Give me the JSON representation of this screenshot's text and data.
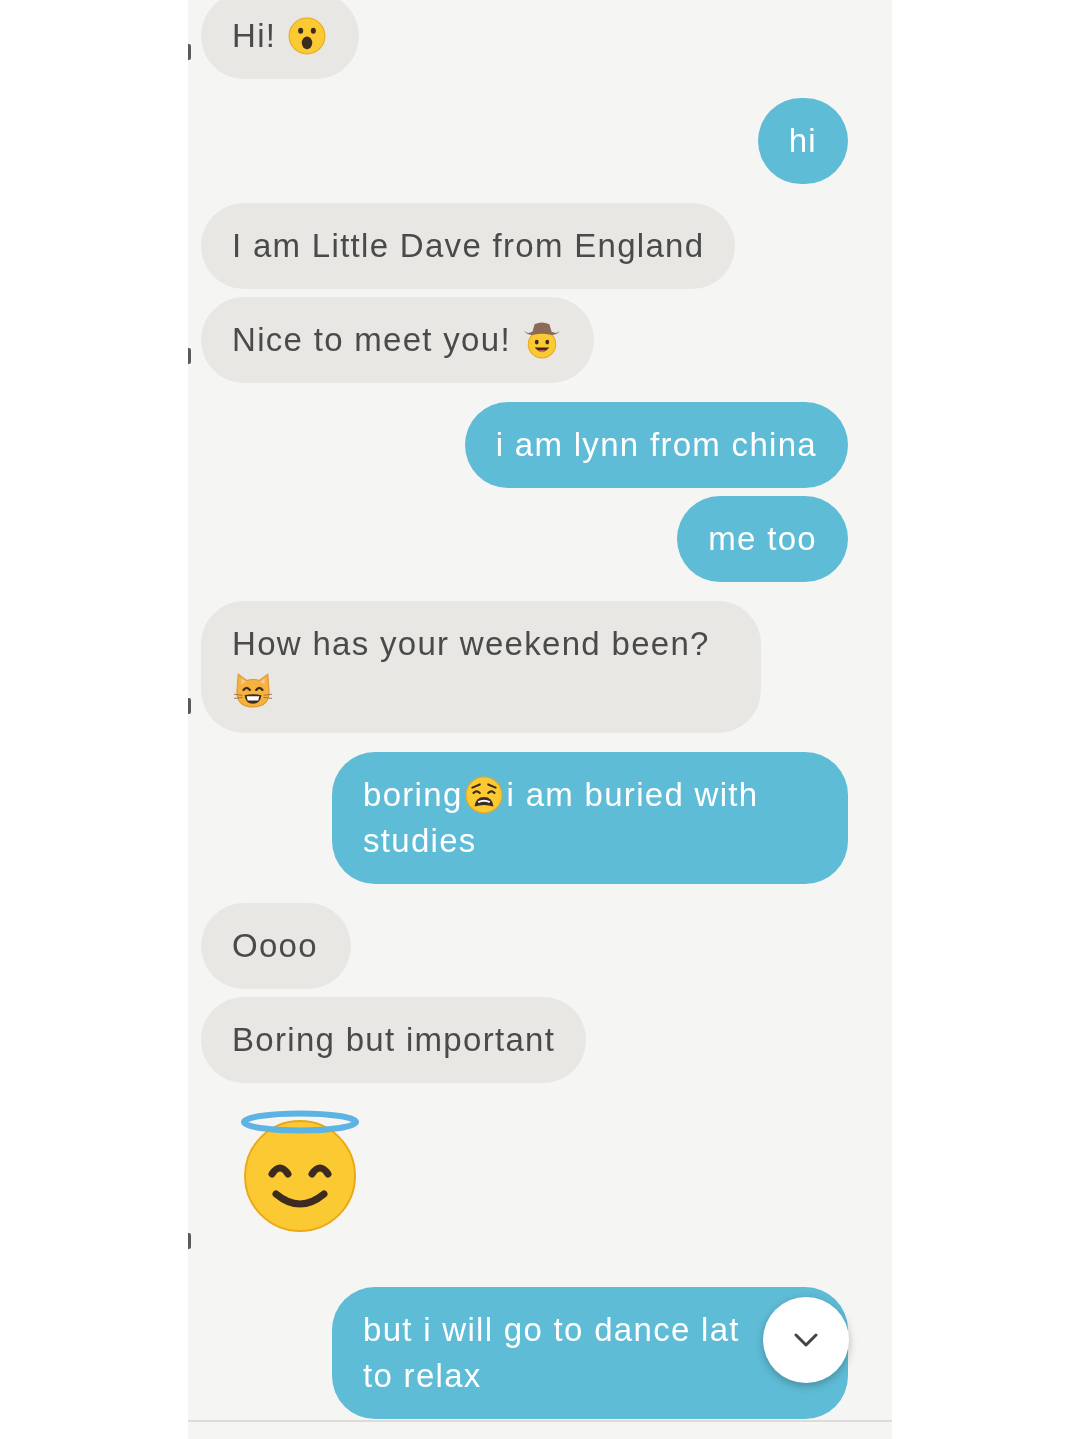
{
  "messages": [
    {
      "kind": "bubble",
      "outgoing": false,
      "avatar_edge": true,
      "lines": [
        [
          {
            "kind": "text",
            "text": "Hi!"
          },
          {
            "kind": "emoji"
          }
        ]
      ]
    },
    {
      "kind": "bubble",
      "outgoing": true,
      "lines": [
        [
          {
            "kind": "text",
            "text": "hi"
          }
        ]
      ]
    },
    {
      "kind": "bubble",
      "outgoing": false,
      "avatar_edge": false,
      "lines": [
        [
          {
            "kind": "text",
            "text": "I am Little Dave from England"
          }
        ]
      ]
    },
    {
      "kind": "bubble",
      "outgoing": false,
      "avatar_edge": true,
      "lines": [
        [
          {
            "kind": "text",
            "text": "Nice to meet you!"
          },
          {
            "kind": "emoji"
          }
        ]
      ]
    },
    {
      "kind": "bubble",
      "outgoing": true,
      "lines": [
        [
          {
            "kind": "text",
            "text": "i am lynn from china"
          }
        ]
      ]
    },
    {
      "kind": "bubble",
      "outgoing": true,
      "lines": [
        [
          {
            "kind": "text",
            "text": "me too"
          }
        ]
      ]
    },
    {
      "kind": "bubble",
      "outgoing": false,
      "avatar_edge": true,
      "lines": [
        [
          {
            "kind": "text",
            "text": "How has your weekend been?"
          }
        ],
        [
          {
            "kind": "emoji"
          }
        ]
      ]
    },
    {
      "kind": "bubble",
      "outgoing": true,
      "lines": [
        [
          {
            "kind": "text",
            "text": "boring"
          },
          {
            "kind": "emoji"
          },
          {
            "kind": "text",
            "text": "i am buried with"
          }
        ],
        [
          {
            "kind": "text",
            "text": "studies"
          }
        ]
      ]
    },
    {
      "kind": "bubble",
      "outgoing": false,
      "avatar_edge": false,
      "lines": [
        [
          {
            "kind": "text",
            "text": "Oooo"
          }
        ]
      ]
    },
    {
      "kind": "bubble",
      "outgoing": false,
      "avatar_edge": false,
      "lines": [
        [
          {
            "kind": "text",
            "text": "Boring but important"
          }
        ]
      ]
    },
    {
      "kind": "big_emoji",
      "outgoing": false,
      "avatar_edge": true
    },
    {
      "kind": "bubble",
      "outgoing": true,
      "lines": [
        [
          {
            "kind": "text",
            "text": "but i will go to dance lat"
          }
        ],
        [
          {
            "kind": "text",
            "text": "to relax"
          }
        ]
      ]
    }
  ]
}
